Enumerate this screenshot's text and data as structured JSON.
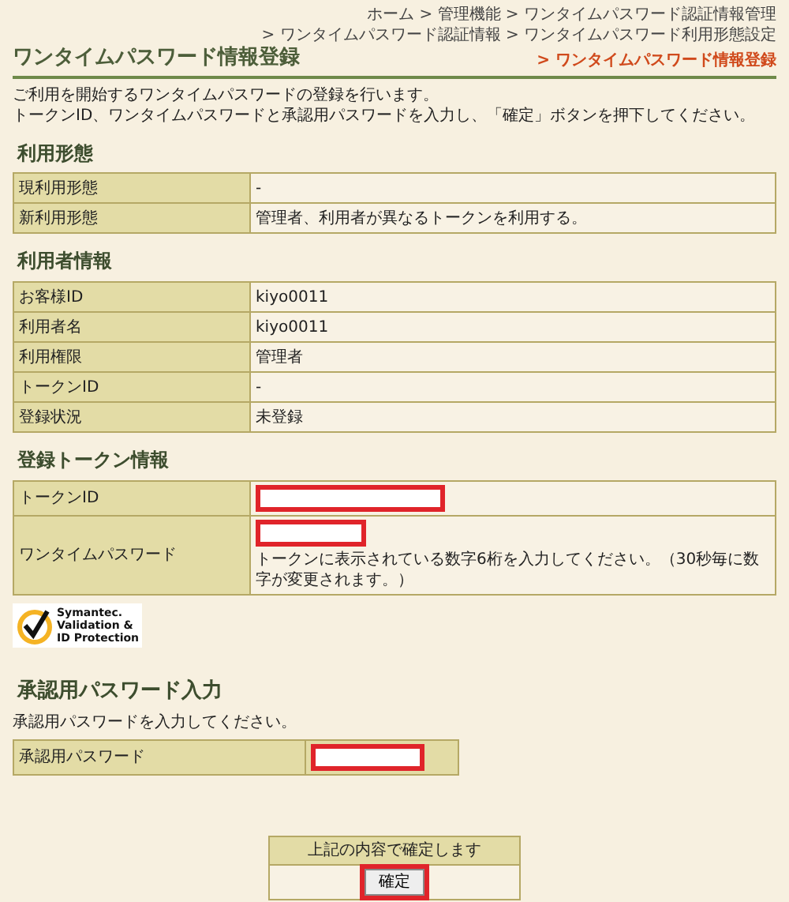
{
  "header": {
    "title": "ワンタイムパスワード情報登録",
    "breadcrumb": [
      {
        "text": "ホーム > 管理機能 > ワンタイムパスワード認証情報管理",
        "current": false
      },
      {
        "text": "> ワンタイムパスワード認証情報 > ワンタイムパスワード利用形態設定",
        "current": false
      },
      {
        "text": "> ワンタイムパスワード情報登録",
        "current": true
      }
    ]
  },
  "intro": [
    "ご利用を開始するワンタイムパスワードの登録を行います。",
    "トークンID、ワンタイムパスワードと承認用パスワードを入力し、「確定」ボタンを押下してください。"
  ],
  "sections": [
    {
      "heading": "利用形態",
      "rows": [
        {
          "kind": "text",
          "label": "現利用形態",
          "value": "-"
        },
        {
          "kind": "text",
          "label": "新利用形態",
          "value": "管理者、利用者が異なるトークンを利用する。"
        }
      ]
    },
    {
      "heading": "利用者情報",
      "rows": [
        {
          "kind": "text",
          "label": "お客様ID",
          "value": "kiyo0011"
        },
        {
          "kind": "text",
          "label": "利用者名",
          "value": "kiyo0011"
        },
        {
          "kind": "text",
          "label": "利用権限",
          "value": "管理者"
        },
        {
          "kind": "text",
          "label": "トークンID",
          "value": "-"
        },
        {
          "kind": "text",
          "label": "登録状況",
          "value": "未登録"
        }
      ]
    },
    {
      "heading": "登録トークン情報",
      "rows": [
        {
          "kind": "input",
          "label": "トークンID",
          "highlighted": true
        },
        {
          "kind": "input",
          "label": "ワンタイムパスワード",
          "highlighted": true,
          "hint": "トークンに表示されている数字6桁を入力してください。（30秒毎に数字が変更されます。）"
        }
      ]
    }
  ],
  "logo": {
    "lines": [
      "Symantec.",
      "Validation &",
      "ID Protection"
    ]
  },
  "approval": {
    "heading": "承認用パスワード入力",
    "description": "承認用パスワードを入力してください。",
    "label": "承認用パスワード",
    "highlighted": true
  },
  "confirm": {
    "caption": "上記の内容で確定します",
    "button": "確定",
    "highlighted": true
  }
}
